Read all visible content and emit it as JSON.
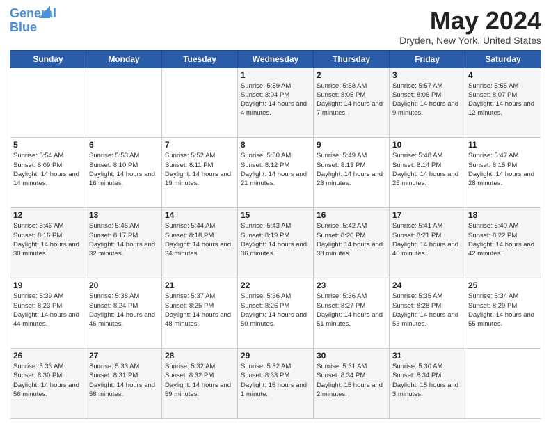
{
  "header": {
    "logo_line1": "General",
    "logo_line2": "Blue",
    "month_title": "May 2024",
    "location": "Dryden, New York, United States"
  },
  "days_of_week": [
    "Sunday",
    "Monday",
    "Tuesday",
    "Wednesday",
    "Thursday",
    "Friday",
    "Saturday"
  ],
  "weeks": [
    [
      {
        "day": "",
        "info": ""
      },
      {
        "day": "",
        "info": ""
      },
      {
        "day": "",
        "info": ""
      },
      {
        "day": "1",
        "info": "Sunrise: 5:59 AM\nSunset: 8:04 PM\nDaylight: 14 hours\nand 4 minutes."
      },
      {
        "day": "2",
        "info": "Sunrise: 5:58 AM\nSunset: 8:05 PM\nDaylight: 14 hours\nand 7 minutes."
      },
      {
        "day": "3",
        "info": "Sunrise: 5:57 AM\nSunset: 8:06 PM\nDaylight: 14 hours\nand 9 minutes."
      },
      {
        "day": "4",
        "info": "Sunrise: 5:55 AM\nSunset: 8:07 PM\nDaylight: 14 hours\nand 12 minutes."
      }
    ],
    [
      {
        "day": "5",
        "info": "Sunrise: 5:54 AM\nSunset: 8:09 PM\nDaylight: 14 hours\nand 14 minutes."
      },
      {
        "day": "6",
        "info": "Sunrise: 5:53 AM\nSunset: 8:10 PM\nDaylight: 14 hours\nand 16 minutes."
      },
      {
        "day": "7",
        "info": "Sunrise: 5:52 AM\nSunset: 8:11 PM\nDaylight: 14 hours\nand 19 minutes."
      },
      {
        "day": "8",
        "info": "Sunrise: 5:50 AM\nSunset: 8:12 PM\nDaylight: 14 hours\nand 21 minutes."
      },
      {
        "day": "9",
        "info": "Sunrise: 5:49 AM\nSunset: 8:13 PM\nDaylight: 14 hours\nand 23 minutes."
      },
      {
        "day": "10",
        "info": "Sunrise: 5:48 AM\nSunset: 8:14 PM\nDaylight: 14 hours\nand 25 minutes."
      },
      {
        "day": "11",
        "info": "Sunrise: 5:47 AM\nSunset: 8:15 PM\nDaylight: 14 hours\nand 28 minutes."
      }
    ],
    [
      {
        "day": "12",
        "info": "Sunrise: 5:46 AM\nSunset: 8:16 PM\nDaylight: 14 hours\nand 30 minutes."
      },
      {
        "day": "13",
        "info": "Sunrise: 5:45 AM\nSunset: 8:17 PM\nDaylight: 14 hours\nand 32 minutes."
      },
      {
        "day": "14",
        "info": "Sunrise: 5:44 AM\nSunset: 8:18 PM\nDaylight: 14 hours\nand 34 minutes."
      },
      {
        "day": "15",
        "info": "Sunrise: 5:43 AM\nSunset: 8:19 PM\nDaylight: 14 hours\nand 36 minutes."
      },
      {
        "day": "16",
        "info": "Sunrise: 5:42 AM\nSunset: 8:20 PM\nDaylight: 14 hours\nand 38 minutes."
      },
      {
        "day": "17",
        "info": "Sunrise: 5:41 AM\nSunset: 8:21 PM\nDaylight: 14 hours\nand 40 minutes."
      },
      {
        "day": "18",
        "info": "Sunrise: 5:40 AM\nSunset: 8:22 PM\nDaylight: 14 hours\nand 42 minutes."
      }
    ],
    [
      {
        "day": "19",
        "info": "Sunrise: 5:39 AM\nSunset: 8:23 PM\nDaylight: 14 hours\nand 44 minutes."
      },
      {
        "day": "20",
        "info": "Sunrise: 5:38 AM\nSunset: 8:24 PM\nDaylight: 14 hours\nand 46 minutes."
      },
      {
        "day": "21",
        "info": "Sunrise: 5:37 AM\nSunset: 8:25 PM\nDaylight: 14 hours\nand 48 minutes."
      },
      {
        "day": "22",
        "info": "Sunrise: 5:36 AM\nSunset: 8:26 PM\nDaylight: 14 hours\nand 50 minutes."
      },
      {
        "day": "23",
        "info": "Sunrise: 5:36 AM\nSunset: 8:27 PM\nDaylight: 14 hours\nand 51 minutes."
      },
      {
        "day": "24",
        "info": "Sunrise: 5:35 AM\nSunset: 8:28 PM\nDaylight: 14 hours\nand 53 minutes."
      },
      {
        "day": "25",
        "info": "Sunrise: 5:34 AM\nSunset: 8:29 PM\nDaylight: 14 hours\nand 55 minutes."
      }
    ],
    [
      {
        "day": "26",
        "info": "Sunrise: 5:33 AM\nSunset: 8:30 PM\nDaylight: 14 hours\nand 56 minutes."
      },
      {
        "day": "27",
        "info": "Sunrise: 5:33 AM\nSunset: 8:31 PM\nDaylight: 14 hours\nand 58 minutes."
      },
      {
        "day": "28",
        "info": "Sunrise: 5:32 AM\nSunset: 8:32 PM\nDaylight: 14 hours\nand 59 minutes."
      },
      {
        "day": "29",
        "info": "Sunrise: 5:32 AM\nSunset: 8:33 PM\nDaylight: 15 hours\nand 1 minute."
      },
      {
        "day": "30",
        "info": "Sunrise: 5:31 AM\nSunset: 8:34 PM\nDaylight: 15 hours\nand 2 minutes."
      },
      {
        "day": "31",
        "info": "Sunrise: 5:30 AM\nSunset: 8:34 PM\nDaylight: 15 hours\nand 3 minutes."
      },
      {
        "day": "",
        "info": ""
      }
    ]
  ]
}
